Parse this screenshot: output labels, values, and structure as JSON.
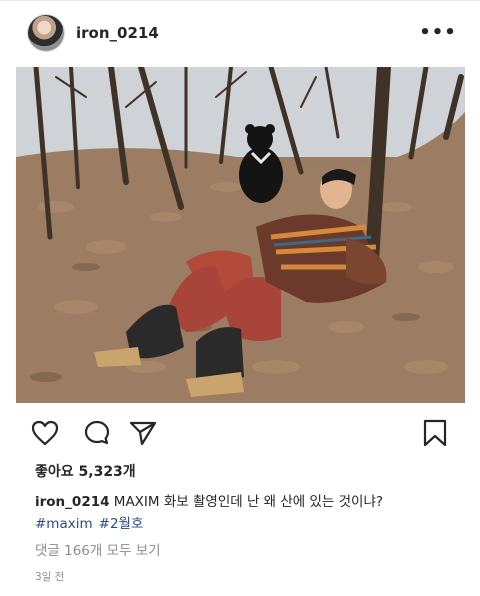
{
  "post": {
    "username": "iron_0214",
    "more_icon": "more-horizontal-icon",
    "photo_alt": "",
    "likes": "좋아요 5,323개",
    "caption_user": "iron_0214",
    "caption_text": "MAXIM 화보 촬영인데 난 왜 산에 있는 것이냐?",
    "hashtags": [
      "#maxim",
      "#2월호"
    ],
    "comments_link": "댓글 166개 모두 보기",
    "timestamp": "3일 전",
    "icons": [
      "heart-icon",
      "comment-icon",
      "share-icon",
      "bookmark-icon"
    ]
  }
}
